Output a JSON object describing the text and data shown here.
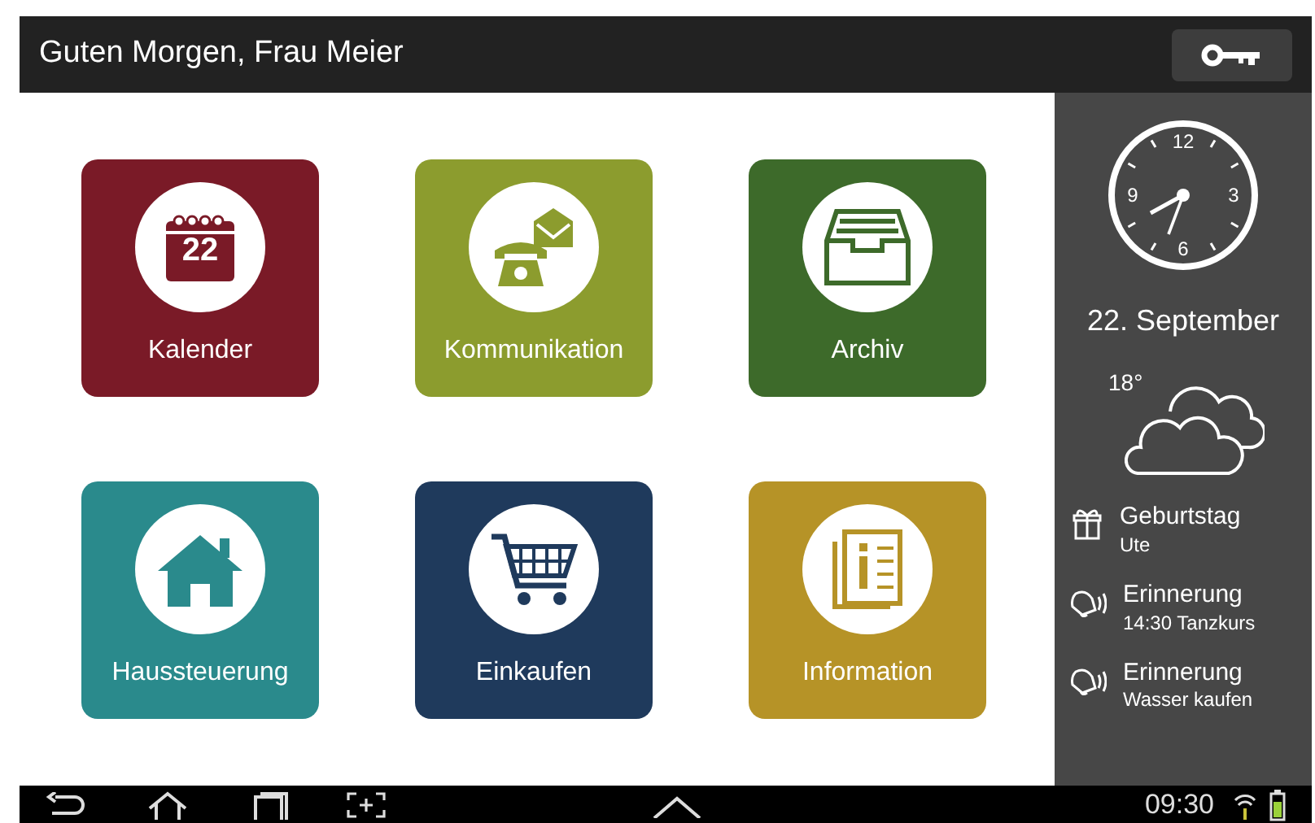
{
  "header": {
    "greeting": "Guten Morgen, Frau Meier"
  },
  "tiles": [
    {
      "label": "Kalender",
      "kind": "calendar",
      "badge": "22",
      "color": "#7a1a27"
    },
    {
      "label": "Kommunikation",
      "kind": "phone",
      "color": "#8c9c2e"
    },
    {
      "label": "Archiv",
      "kind": "archive",
      "color": "#3d6a2a"
    },
    {
      "label": "Haussteuerung",
      "kind": "house",
      "color": "#2a8a8c"
    },
    {
      "label": "Einkaufen",
      "kind": "cart",
      "color": "#1f3a5c"
    },
    {
      "label": "Information",
      "kind": "info",
      "color": "#b69327"
    }
  ],
  "sidebar": {
    "clock": {
      "numerals": [
        "12",
        "3",
        "6",
        "9"
      ]
    },
    "date": "22. September",
    "weather": {
      "temperature": "18°"
    },
    "events": [
      {
        "kind": "gift",
        "title": "Geburtstag",
        "detail": "Ute"
      },
      {
        "kind": "bell",
        "title": "Erinnerung",
        "detail": "14:30 Tanzkurs"
      },
      {
        "kind": "bell",
        "title": "Erinnerung",
        "detail": "Wasser kaufen"
      }
    ]
  },
  "status_bar": {
    "time": "09:30"
  }
}
